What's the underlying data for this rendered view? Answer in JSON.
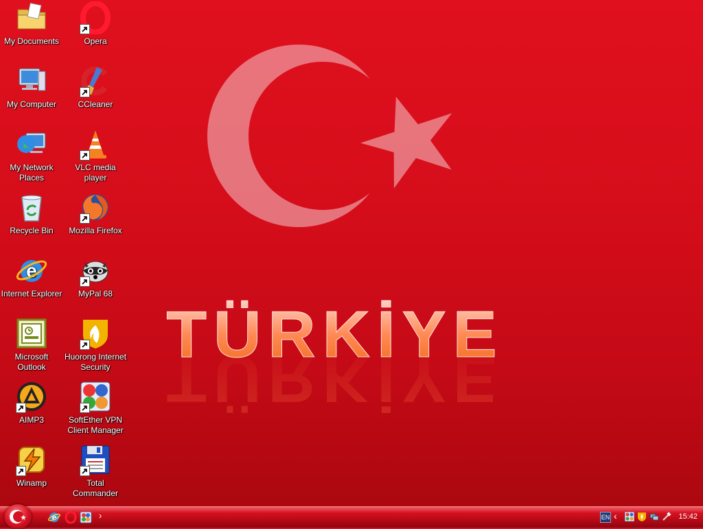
{
  "wallpaper": {
    "title": "TÜRKİYE"
  },
  "desktop": {
    "icons": [
      {
        "id": "my-documents",
        "label": "My Documents",
        "shortcut": false,
        "icon": "folder-icon"
      },
      {
        "id": "my-computer",
        "label": "My Computer",
        "shortcut": false,
        "icon": "computer-icon"
      },
      {
        "id": "my-network-places",
        "label": "My Network Places",
        "shortcut": false,
        "icon": "network-icon"
      },
      {
        "id": "recycle-bin",
        "label": "Recycle Bin",
        "shortcut": false,
        "icon": "recycle-bin-icon"
      },
      {
        "id": "internet-explorer",
        "label": "Internet Explorer",
        "shortcut": false,
        "icon": "ie-icon"
      },
      {
        "id": "microsoft-outlook",
        "label": "Microsoft Outlook",
        "shortcut": false,
        "icon": "outlook-icon"
      },
      {
        "id": "aimp3",
        "label": "AIMP3",
        "shortcut": true,
        "icon": "aimp-icon"
      },
      {
        "id": "winamp",
        "label": "Winamp",
        "shortcut": true,
        "icon": "winamp-icon"
      },
      {
        "id": "opera",
        "label": "Opera",
        "shortcut": true,
        "icon": "opera-icon"
      },
      {
        "id": "ccleaner",
        "label": "CCleaner",
        "shortcut": true,
        "icon": "ccleaner-icon"
      },
      {
        "id": "vlc",
        "label": "VLC media player",
        "shortcut": true,
        "icon": "vlc-icon"
      },
      {
        "id": "firefox",
        "label": "Mozilla Firefox",
        "shortcut": true,
        "icon": "firefox-icon"
      },
      {
        "id": "mypal",
        "label": "MyPal 68",
        "shortcut": true,
        "icon": "mypal-icon"
      },
      {
        "id": "huorong",
        "label": "Huorong Internet Security",
        "shortcut": true,
        "icon": "huorong-icon"
      },
      {
        "id": "softether",
        "label": "SoftEther VPN Client Manager",
        "shortcut": true,
        "icon": "softether-icon"
      },
      {
        "id": "total-commander",
        "label": "Total Commander",
        "shortcut": true,
        "icon": "total-commander-icon"
      }
    ]
  },
  "taskbar": {
    "quick_launch": [
      "ie-icon",
      "opera-icon",
      "softether-icon"
    ],
    "more": "›",
    "tray": {
      "language": "EN",
      "chevron": "‹",
      "clock": "15:42"
    }
  }
}
